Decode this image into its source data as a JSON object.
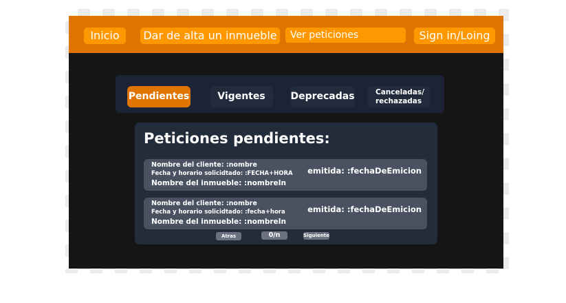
{
  "nav": {
    "inicio": "Inicio",
    "alta": "Dar de alta un inmueble",
    "ver": "Ver peticiones",
    "sign": "Sign in/Loing"
  },
  "tabs": [
    {
      "label": "Pendientes",
      "active": true
    },
    {
      "label": "Vigentes",
      "active": false
    },
    {
      "label": "Deprecadas",
      "active": false
    },
    {
      "label_line1": "Canceladas/",
      "label_line2": "rechazadas",
      "active": false
    }
  ],
  "panel": {
    "title": "Peticiones pendientes:",
    "requests": [
      {
        "cliente": "Nombre del cliente: :nombre",
        "fecha": "Fecha y horario solicidtado: :FECHA+HORA",
        "inmueble": "Nombre del inmueble: :nombreIn",
        "emitida": "emitida: :fechaDeEmicion"
      },
      {
        "cliente": "Nombre del cliente: :nombre",
        "fecha": "Fecha y horario solicidtado: :fecha+hora",
        "inmueble": "Nombre del inmueble: :nombreIn",
        "emitida": "emitida: :fechaDeEmicion"
      }
    ]
  },
  "pagination": {
    "atras": "Atras",
    "count": "0/n",
    "siguiente": "Siguiente"
  },
  "colors": {
    "nav_bar": "#e07400",
    "nav_button": "#ff9800",
    "background": "#151515",
    "tab_bar": "#1b2334",
    "panel": "#232c3a",
    "card": "#4a5161",
    "active_tab": "#e07400"
  }
}
